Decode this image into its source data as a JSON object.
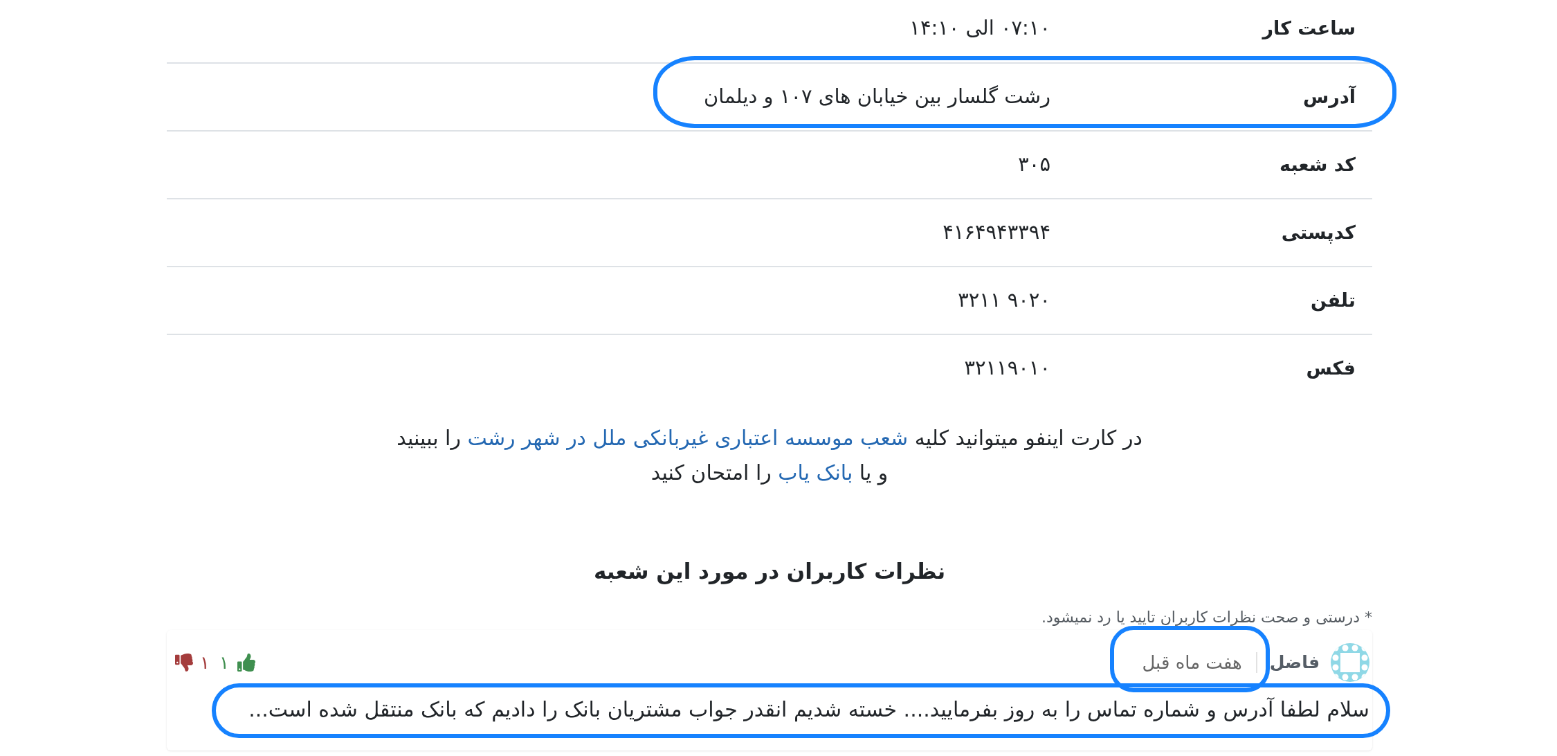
{
  "info_rows": [
    {
      "label": "ساعت کار",
      "value": "۰۷:۱۰ الی ۱۴:۱۰",
      "highlighted": false
    },
    {
      "label": "آدرس",
      "value": "رشت گلسار بین خیابان های ۱۰۷ و دیلمان",
      "highlighted": true
    },
    {
      "label": "کد شعبه",
      "value": "۳۰۵",
      "highlighted": false
    },
    {
      "label": "کدپستی",
      "value": "۴۱۶۴۹۴۳۳۹۴",
      "highlighted": false
    },
    {
      "label": "تلفن",
      "value": "۳۲۱۱ ۹۰۲۰",
      "highlighted": false
    },
    {
      "label": "فکس",
      "value": "۳۲۱۱۹۰۱۰",
      "highlighted": false
    }
  ],
  "info_text": [
    {
      "before": "در کارت اینفو میتوانید کلیه",
      "link": "شعب موسسه اعتباری غیربانکی ملل در شهر رشت",
      "after": "را ببینید"
    },
    {
      "before": "و یا",
      "link": "بانک یاب",
      "after": "را امتحان کنید"
    }
  ],
  "comments_section": {
    "title": "نظرات کاربران در مورد این شعبه",
    "disclaimer": "* درستی و صحت نظرات کاربران تایید یا رد نمیشود.",
    "comments": [
      {
        "author": "فاضل",
        "time": "هفت ماه قبل",
        "time_highlighted": true,
        "likes": "۱",
        "dislikes": "۱",
        "text": "سلام لطفا آدرس و شماره تماس را به روز بفرمایید.... خسته شدیم انقدر جواب مشتریان بانک را دادیم که بانک منتقل شده است...",
        "text_highlighted": true
      }
    ]
  }
}
